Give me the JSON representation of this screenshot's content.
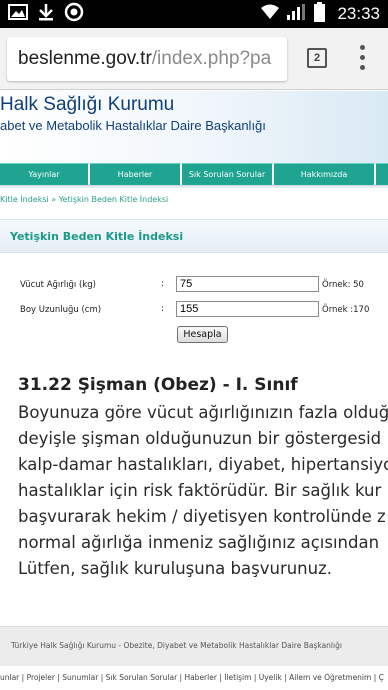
{
  "status_bar": {
    "time": "23:33",
    "icons": [
      "image-icon",
      "download-icon",
      "notification-circle-icon",
      "wifi-icon",
      "signal-icon",
      "battery-icon"
    ]
  },
  "browser": {
    "url_host": "beslenme.gov.tr",
    "url_path": "/index.php?pa",
    "tab_count": "2"
  },
  "header": {
    "org_name": "Halk Sağlığı Kurumu",
    "dept_name": "abet ve Metabolik Hastalıklar Daire Başkanlığı"
  },
  "nav": {
    "items": [
      "Yayınlar",
      "Haberler",
      "Sık Sorulan Sorular",
      "Hakkımızda"
    ]
  },
  "breadcrumb": "Kitle İndeksi » Yetişkin Beden Kitle İndeksi",
  "section_title": "Yetişkin Beden Kitle İndeksi",
  "form": {
    "weight_label": "Vücut Ağırlığı (kg)",
    "weight_value": "75",
    "weight_example": "Örnek: 50",
    "height_label": "Boy Uzunluğu (cm)",
    "height_value": "155",
    "height_example": "Örnek :170",
    "colon": ":",
    "submit_label": "Hesapla"
  },
  "result": {
    "title": "31.22 Şişman (Obez) - I. Sınıf",
    "lines": [
      "Boyunuza göre vücut ağırlığınızın fazla olduğ",
      "deyişle şişman olduğunuzun bir göstergesid",
      "kalp-damar hastalıkları, diyabet, hipertansiyo",
      "hastalıklar için risk faktörüdür. Bir sağlık kur",
      "başvurarak hekim / diyetisyen kontrolünde z",
      "normal ağırlığa inmeniz sağlığınız açısından",
      "Lütfen, sağlık kuruluşuna başvurunuz."
    ]
  },
  "footer": {
    "text": "Türkiye Halk Sağlığı Kurumu - Obezite, Diyabet ve Metabolik Hastalıklar Daire Başkanlığı",
    "links": "unlar | Projeler | Sunumlar | Sık Sorulan Sorular | Haberler | İletişim | Üyelik | Ailem ve Öğretmenim | Ç"
  },
  "colors": {
    "nav_teal": "#1fa492",
    "brand_blue": "#0f3f7a",
    "accent_teal": "#1b9a88"
  }
}
